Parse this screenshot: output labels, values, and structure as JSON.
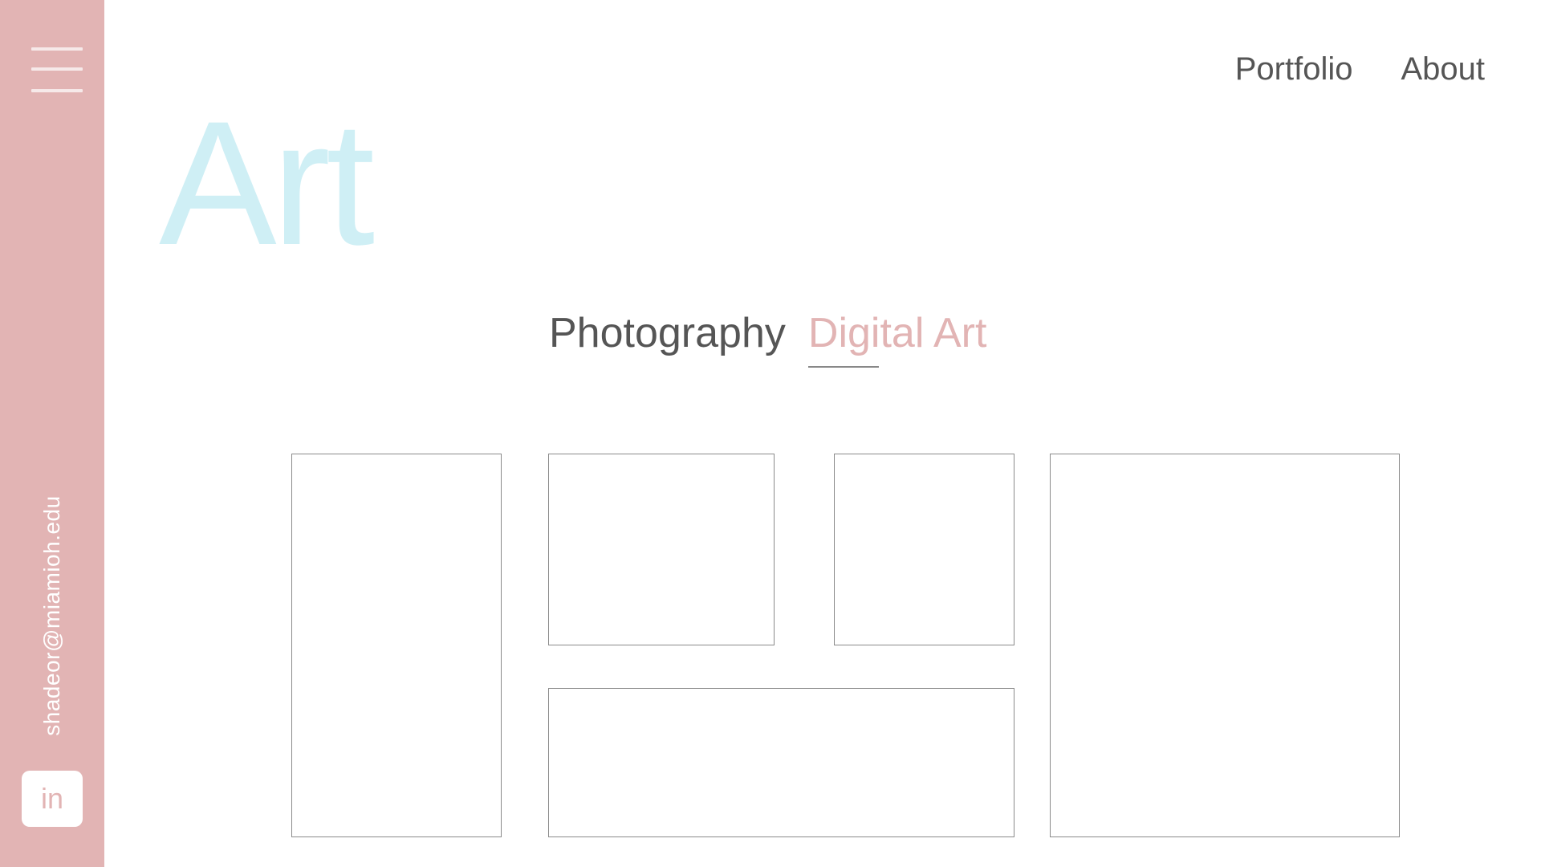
{
  "sidebar": {
    "menu_icon": "hamburger-menu-icon",
    "email": "shadeor@miamioh.edu",
    "linkedin_label": "in",
    "background_color": "#e2b4b4"
  },
  "nav": {
    "items": [
      {
        "label": "Portfolio"
      },
      {
        "label": "About"
      }
    ]
  },
  "hero": {
    "title": "Art",
    "color": "#cfeff5"
  },
  "tabs": {
    "items": [
      {
        "label": "Photography",
        "active": false
      },
      {
        "label": "Digital Art",
        "active": true
      }
    ],
    "active_color": "#e2b4b4"
  },
  "gallery": {
    "frames": [
      "artwork-1",
      "artwork-2",
      "artwork-3",
      "artwork-4",
      "artwork-5"
    ]
  }
}
